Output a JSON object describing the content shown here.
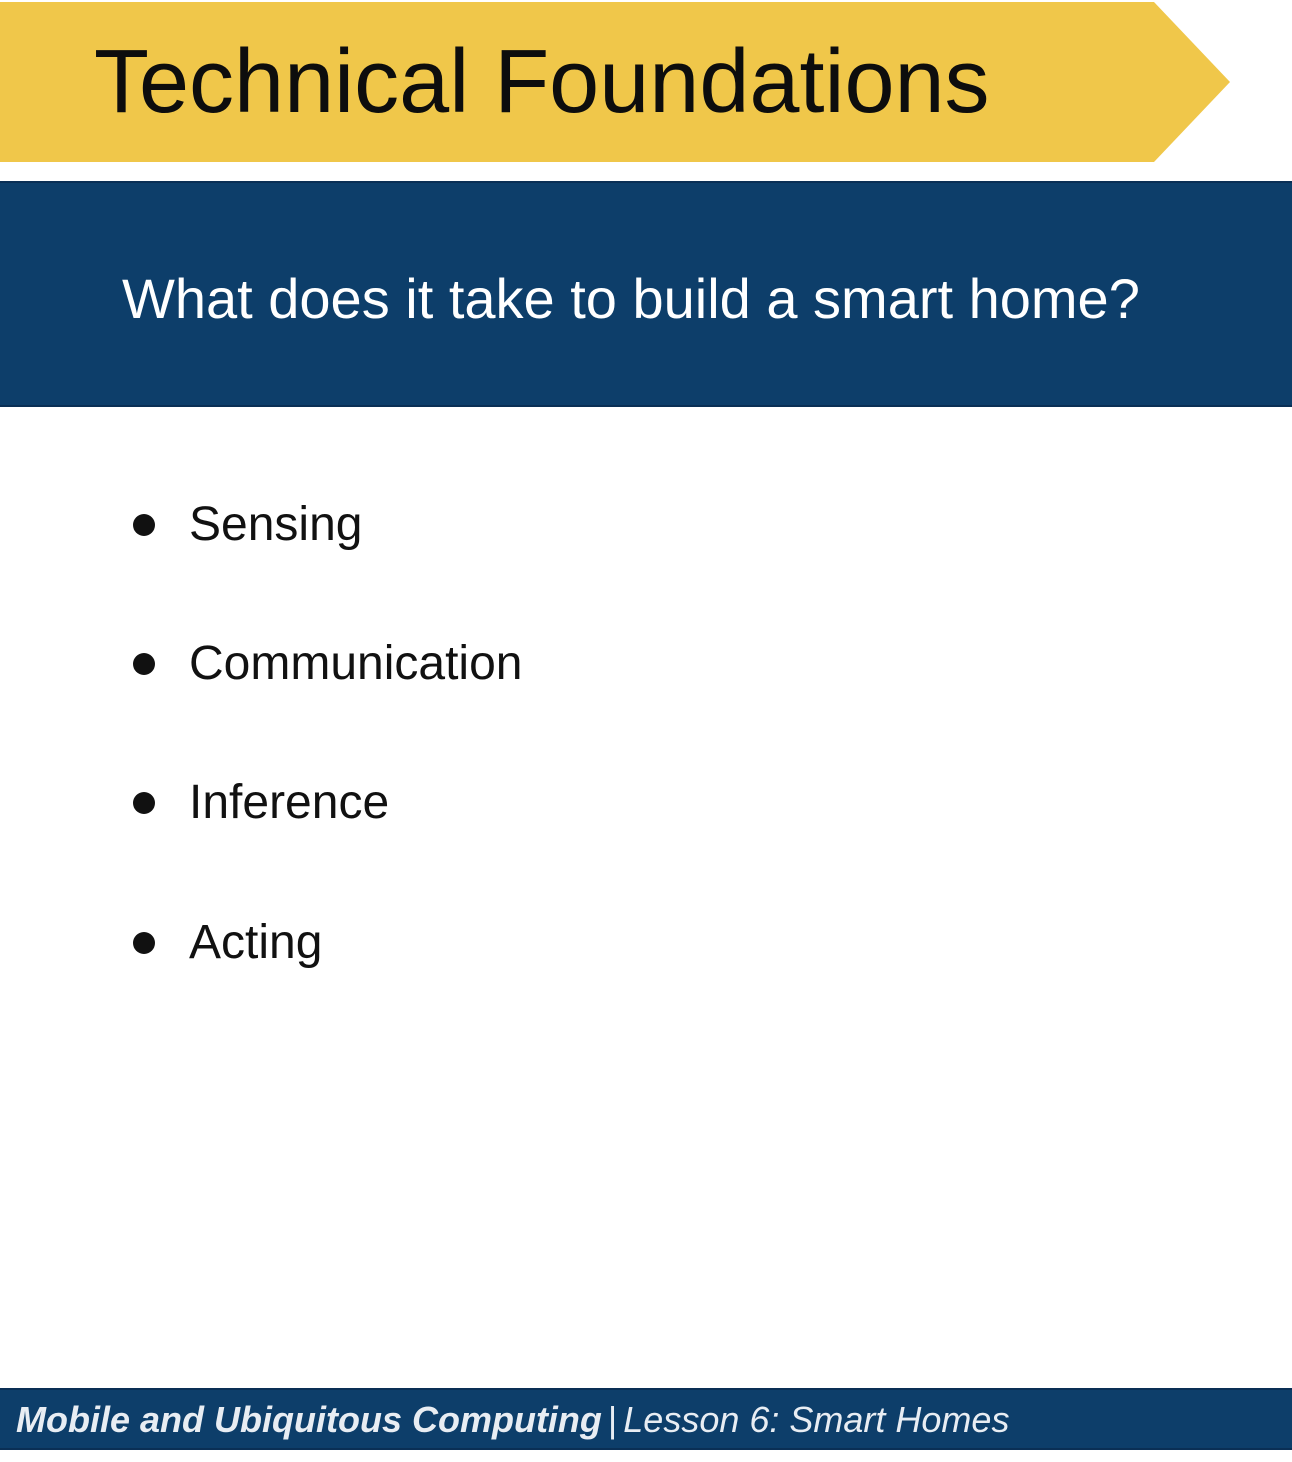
{
  "slide": {
    "title": "Technical Foundations",
    "question": "What does it take to build a smart home?",
    "bullets": [
      {
        "label": "Sensing"
      },
      {
        "label": "Communication"
      },
      {
        "label": "Inference"
      },
      {
        "label": "Acting"
      }
    ]
  },
  "footer": {
    "course": "Mobile and Ubiquitous Computing",
    "separator": "|",
    "lesson": "Lesson 6: Smart Homes"
  },
  "colors": {
    "title_banner": "#f0c74a",
    "navy": "#0d3e6a",
    "text_dark": "#111111",
    "text_light": "#ffffff"
  }
}
